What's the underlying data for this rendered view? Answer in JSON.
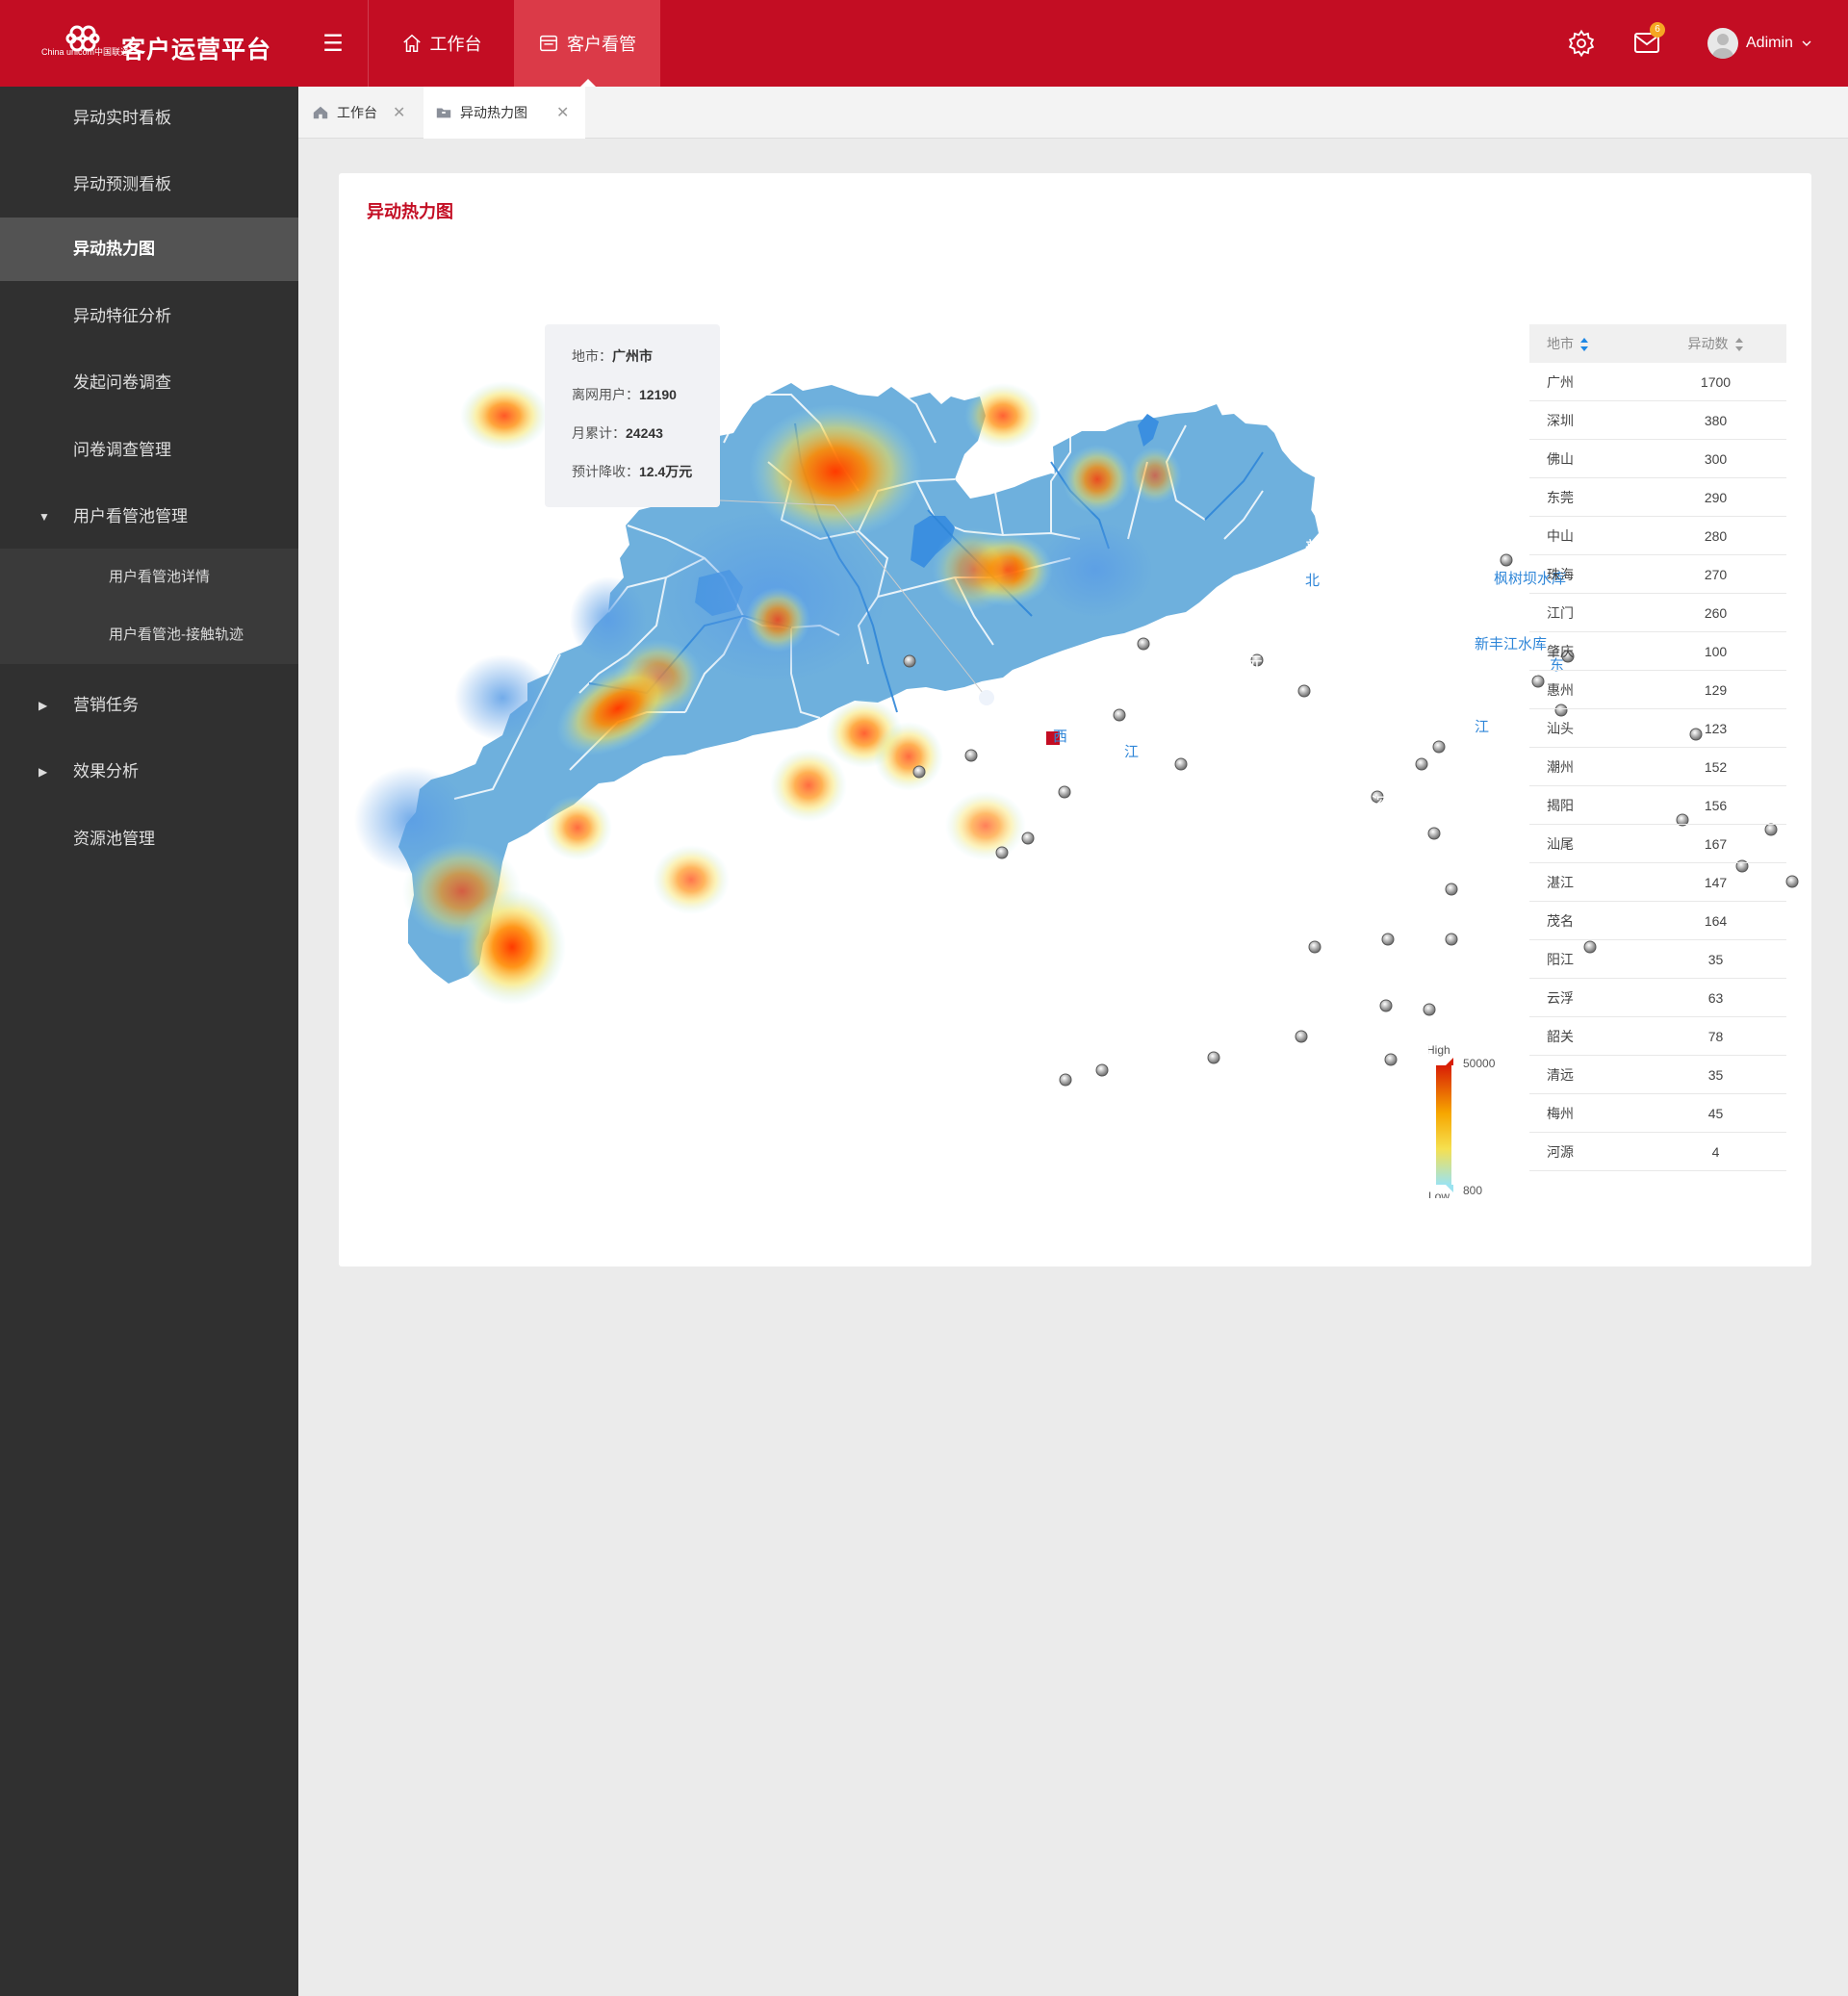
{
  "app": {
    "title": "客户运营平台",
    "logo_text": "China unicom中国联通",
    "nav": [
      {
        "label": "工作台",
        "icon": "home-icon"
      },
      {
        "label": "客户看管",
        "icon": "window-icon"
      }
    ],
    "mail_badge": "6",
    "user": "Adimin"
  },
  "sidebar": {
    "items": [
      {
        "label": "异动实时看板"
      },
      {
        "label": "异动预测看板"
      },
      {
        "label": "异动热力图",
        "active": true
      },
      {
        "label": "异动特征分析"
      },
      {
        "label": "发起问卷调查"
      },
      {
        "label": "问卷调查管理"
      },
      {
        "label": "用户看管池管理",
        "expanded": true
      },
      {
        "label": "营销任务"
      },
      {
        "label": "效果分析"
      },
      {
        "label": "资源池管理"
      }
    ],
    "sub_items": [
      {
        "label": "用户看管池详情"
      },
      {
        "label": "用户看管池-接触轨迹"
      }
    ]
  },
  "tabs": [
    {
      "label": "工作台"
    },
    {
      "label": "异动热力图"
    }
  ],
  "card": {
    "title": "异动热力图"
  },
  "tooltip": {
    "city_label": "地市：",
    "city": "广州市",
    "users_label": "离网用户：",
    "users": "12190",
    "monthly_label": "月累计：",
    "monthly": "24243",
    "revenue_label": "预计降收：",
    "revenue": "12.4万元"
  },
  "map": {
    "cities": [
      {
        "name": "韶关市",
        "intensity": 0.75
      },
      {
        "name": "河源市",
        "intensity": 0.1
      },
      {
        "name": "梅州市",
        "intensity": 0.85
      },
      {
        "name": "潮州市",
        "intensity": 0.6
      },
      {
        "name": "揭阳市",
        "intensity": 0.7
      },
      {
        "name": "汕头",
        "intensity": 0.2
      },
      {
        "name": "汕尾市",
        "intensity": 0.6
      },
      {
        "name": "清远市",
        "intensity": 0.0
      },
      {
        "name": "广州市",
        "intensity": 1.0
      },
      {
        "name": "惠州市",
        "intensity": 0.65
      },
      {
        "name": "肇庆市",
        "intensity": 0.7
      },
      {
        "name": "佛山市",
        "intensity": 0.0
      },
      {
        "name": "东莞市",
        "intensity": 0.7
      },
      {
        "name": "深圳市",
        "intensity": 0.75
      },
      {
        "name": "云浮市",
        "intensity": 0.8
      },
      {
        "name": "江门市",
        "intensity": 0.7
      },
      {
        "name": "中",
        "intensity": 0.0
      },
      {
        "name": "阳江市",
        "intensity": 0.7
      },
      {
        "name": "茂名市",
        "intensity": 0.6
      },
      {
        "name": "湛江市",
        "intensity": 0.9
      }
    ],
    "reservoirs": [
      "枫树坝水库",
      "新丰江水库"
    ],
    "rivers": [
      "北",
      "东",
      "西",
      "江",
      "江"
    ]
  },
  "legend": {
    "high_label": "High",
    "high_value": "50000",
    "low_label": "Low",
    "low_value": "800",
    "colors": [
      "#d81e06",
      "#f7a600",
      "#f5e050",
      "#9be3f0"
    ]
  },
  "table": {
    "headers": [
      "地市",
      "异动数"
    ],
    "rows": [
      [
        "广州",
        "1700"
      ],
      [
        "深圳",
        "380"
      ],
      [
        "佛山",
        "300"
      ],
      [
        "东莞",
        "290"
      ],
      [
        "中山",
        "280"
      ],
      [
        "珠海",
        "270"
      ],
      [
        "江门",
        "260"
      ],
      [
        "肇庆",
        "100"
      ],
      [
        "惠州",
        "129"
      ],
      [
        "汕头",
        "123"
      ],
      [
        "潮州",
        "152"
      ],
      [
        "揭阳",
        "156"
      ],
      [
        "汕尾",
        "167"
      ],
      [
        "湛江",
        "147"
      ],
      [
        "茂名",
        "164"
      ],
      [
        "阳江",
        "35"
      ],
      [
        "云浮",
        "63"
      ],
      [
        "韶关",
        "78"
      ],
      [
        "清远",
        "35"
      ],
      [
        "梅州",
        "45"
      ],
      [
        "河源",
        "4"
      ]
    ]
  },
  "colors": {
    "brand": "#c30d23",
    "sidebar": "#303030",
    "map_land": "#6eb0dd",
    "map_border": "#ffffff",
    "water": "#3b8fe0"
  }
}
